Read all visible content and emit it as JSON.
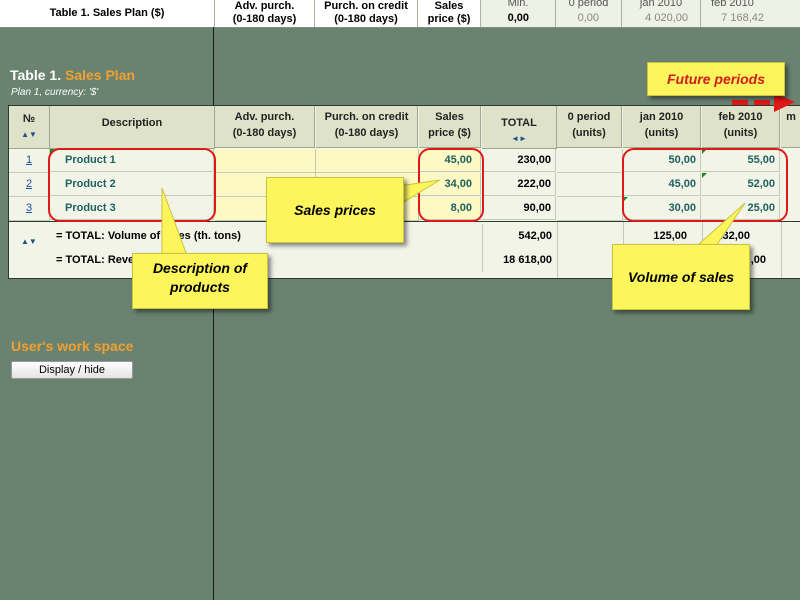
{
  "frozen_header": {
    "title": "Table 1. Sales Plan ($)",
    "columns": [
      {
        "label": "Adv. purch.\n(0-180 days)",
        "value": ""
      },
      {
        "label": "Purch. on credit\n(0-180 days)",
        "value": ""
      },
      {
        "label": "Sales\nprice ($)",
        "value": ""
      },
      {
        "label": "Min.",
        "value": "0,00"
      },
      {
        "label": "0 period",
        "value": "0,00"
      },
      {
        "label": "jan 2010",
        "value": "4 020,00"
      },
      {
        "label": "feb 2010",
        "value": "7 168,42"
      }
    ]
  },
  "section": {
    "title_prefix": "Table 1.",
    "title_accent": "Sales Plan",
    "subtitle": "Plan 1, currency: '$'"
  },
  "table": {
    "headers": {
      "no": "№",
      "no_arrows": "▲▼",
      "description": "Description",
      "adv": "Adv. purch.\n(0-180 days)",
      "credit": "Purch. on credit\n(0-180 days)",
      "price": "Sales\nprice ($)",
      "total": "TOTAL",
      "total_arrows": "◄►",
      "zero": "0 period\n(units)",
      "jan": "jan 2010\n(units)",
      "feb": "feb 2010\n(units)",
      "cut": "m"
    },
    "rows": [
      {
        "no": "1",
        "name": "Product 1",
        "price": "45,00",
        "total": "230,00",
        "jan": "50,00",
        "feb": "55,00"
      },
      {
        "no": "2",
        "name": "Product 2",
        "price": "34,00",
        "total": "222,00",
        "jan": "45,00",
        "feb": "52,00"
      },
      {
        "no": "3",
        "name": "Product 3",
        "price": "8,00",
        "total": "90,00",
        "jan": "30,00",
        "feb": "25,00"
      }
    ],
    "totals": {
      "arrows": "▲▼",
      "volume_label": "= TOTAL: Volume of sales (th. tons)",
      "volume_total": "542,00",
      "volume_jan": "125,00",
      "volume_feb": "132,00",
      "revenue_label": "= TOTAL: Revenue",
      "revenue_total": "18 618,00",
      "revenue_feb": ",00"
    }
  },
  "callouts": {
    "future": "Future periods",
    "prices": "Sales prices",
    "description": "Description of products",
    "volume": "Volume of sales"
  },
  "workspace": {
    "title": "User's work space",
    "button": "Display / hide"
  },
  "colors": {
    "background": "#6a8270",
    "accent": "#f0a030",
    "highlight": "#e01818",
    "callout": "#fdf55c"
  }
}
